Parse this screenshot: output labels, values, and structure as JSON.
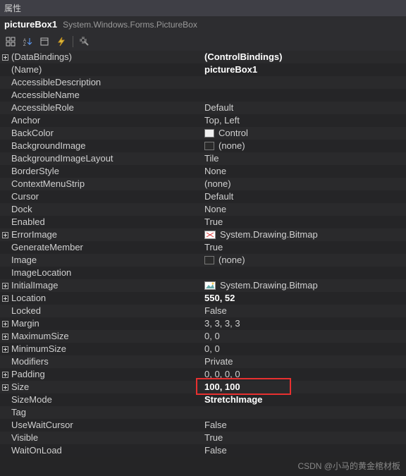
{
  "window": {
    "title": "属性"
  },
  "header": {
    "name": "pictureBox1",
    "type": "System.Windows.Forms.PictureBox"
  },
  "rows": [
    {
      "expand": "+",
      "name": "(DataBindings)",
      "value": "(ControlBindings)",
      "bold": true
    },
    {
      "expand": "",
      "name": "(Name)",
      "value": "pictureBox1",
      "bold": true
    },
    {
      "expand": "",
      "name": "AccessibleDescription",
      "value": ""
    },
    {
      "expand": "",
      "name": "AccessibleName",
      "value": ""
    },
    {
      "expand": "",
      "name": "AccessibleRole",
      "value": "Default"
    },
    {
      "expand": "",
      "name": "Anchor",
      "value": "Top, Left"
    },
    {
      "expand": "",
      "name": "BackColor",
      "value": "Control",
      "swatch": "#f0f0f0"
    },
    {
      "expand": "",
      "name": "BackgroundImage",
      "value": "(none)",
      "swatch": "#2a2a2a"
    },
    {
      "expand": "",
      "name": "BackgroundImageLayout",
      "value": "Tile"
    },
    {
      "expand": "",
      "name": "BorderStyle",
      "value": "None"
    },
    {
      "expand": "",
      "name": "ContextMenuStrip",
      "value": "(none)"
    },
    {
      "expand": "",
      "name": "Cursor",
      "value": "Default"
    },
    {
      "expand": "",
      "name": "Dock",
      "value": "None"
    },
    {
      "expand": "",
      "name": "Enabled",
      "value": "True"
    },
    {
      "expand": "+",
      "name": "ErrorImage",
      "value": "System.Drawing.Bitmap",
      "icon": "error-bmp"
    },
    {
      "expand": "",
      "name": "GenerateMember",
      "value": "True"
    },
    {
      "expand": "",
      "name": "Image",
      "value": "(none)",
      "swatch": "#2a2a2a"
    },
    {
      "expand": "",
      "name": "ImageLocation",
      "value": ""
    },
    {
      "expand": "+",
      "name": "InitialImage",
      "value": "System.Drawing.Bitmap",
      "icon": "initial-bmp"
    },
    {
      "expand": "+",
      "name": "Location",
      "value": "550, 52",
      "bold": true
    },
    {
      "expand": "",
      "name": "Locked",
      "value": "False"
    },
    {
      "expand": "+",
      "name": "Margin",
      "value": "3, 3, 3, 3"
    },
    {
      "expand": "+",
      "name": "MaximumSize",
      "value": "0, 0"
    },
    {
      "expand": "+",
      "name": "MinimumSize",
      "value": "0, 0"
    },
    {
      "expand": "",
      "name": "Modifiers",
      "value": "Private"
    },
    {
      "expand": "+",
      "name": "Padding",
      "value": "0, 0, 0, 0"
    },
    {
      "expand": "+",
      "name": "Size",
      "value": "100, 100",
      "bold": true,
      "highlight": true
    },
    {
      "expand": "",
      "name": "SizeMode",
      "value": "StretchImage",
      "bold": true
    },
    {
      "expand": "",
      "name": "Tag",
      "value": ""
    },
    {
      "expand": "",
      "name": "UseWaitCursor",
      "value": "False"
    },
    {
      "expand": "",
      "name": "Visible",
      "value": "True"
    },
    {
      "expand": "",
      "name": "WaitOnLoad",
      "value": "False"
    }
  ],
  "watermark": "CSDN @小马的黄金棺材板"
}
